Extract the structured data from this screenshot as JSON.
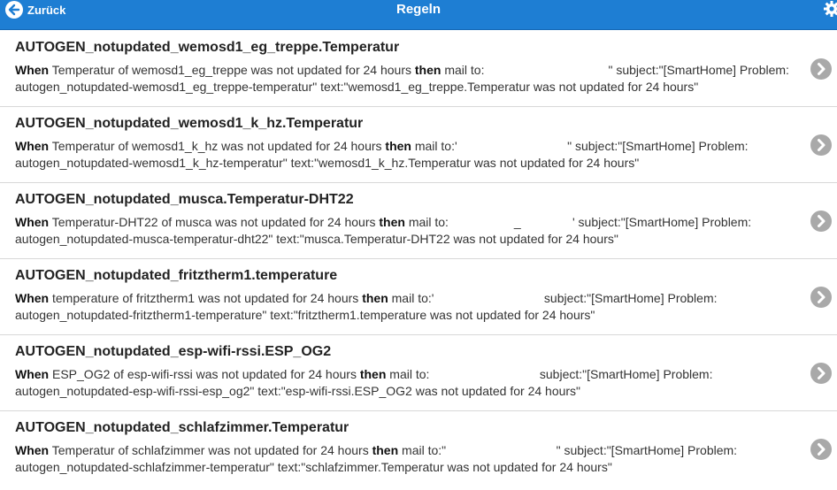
{
  "header": {
    "back_label": "Zurück",
    "title": "Regeln",
    "accent_color": "#1e7ed3",
    "back_icon": "arrow-left-icon",
    "settings_icon": "gear-icon"
  },
  "rules": [
    {
      "title": "AUTOGEN_notupdated_wemosd1_eg_treppe.Temperatur",
      "when": "When",
      "condition": " Temperatur of wemosd1_eg_treppe was not updated for 24 hours ",
      "then": "then",
      "action": " mail to:                                    \" subject:\"[SmartHome] Problem: autogen_notupdated-wemosd1_eg_treppe-temperatur\" text:\"wemosd1_eg_treppe.Temperatur was not updated for 24 hours\""
    },
    {
      "title": "AUTOGEN_notupdated_wemosd1_k_hz.Temperatur",
      "when": "When",
      "condition": " Temperatur of wemosd1_k_hz was not updated for 24 hours ",
      "then": "then",
      "action": " mail to:'                                \" subject:\"[SmartHome] Problem: autogen_notupdated-wemosd1_k_hz-temperatur\" text:\"wemosd1_k_hz.Temperatur was not updated for 24 hours\""
    },
    {
      "title": "AUTOGEN_notupdated_musca.Temperatur-DHT22",
      "when": "When",
      "condition": " Temperatur-DHT22 of musca was not updated for 24 hours ",
      "then": "then",
      "action": " mail to:                   _               ' subject:\"[SmartHome] Problem: autogen_notupdated-musca-temperatur-dht22\" text:\"musca.Temperatur-DHT22 was not updated for 24 hours\""
    },
    {
      "title": "AUTOGEN_notupdated_fritztherm1.temperature",
      "when": "When",
      "condition": " temperature of fritztherm1 was not updated for 24 hours ",
      "then": "then",
      "action": " mail to:'                                subject:\"[SmartHome] Problem: autogen_notupdated-fritztherm1-temperature\" text:\"fritztherm1.temperature was not updated for 24 hours\""
    },
    {
      "title": "AUTOGEN_notupdated_esp-wifi-rssi.ESP_OG2",
      "when": "When",
      "condition": " ESP_OG2 of esp-wifi-rssi was not updated for 24 hours ",
      "then": "then",
      "action": " mail to:                                subject:\"[SmartHome] Problem: autogen_notupdated-esp-wifi-rssi-esp_og2\" text:\"esp-wifi-rssi.ESP_OG2 was not updated for 24 hours\""
    },
    {
      "title": "AUTOGEN_notupdated_schlafzimmer.Temperatur",
      "when": "When",
      "condition": " Temperatur of schlafzimmer was not updated for 24 hours ",
      "then": "then",
      "action": " mail to:\"                                \" subject:\"[SmartHome] Problem: autogen_notupdated-schlafzimmer-temperatur\" text:\"schlafzimmer.Temperatur was not updated for 24 hours\""
    }
  ]
}
